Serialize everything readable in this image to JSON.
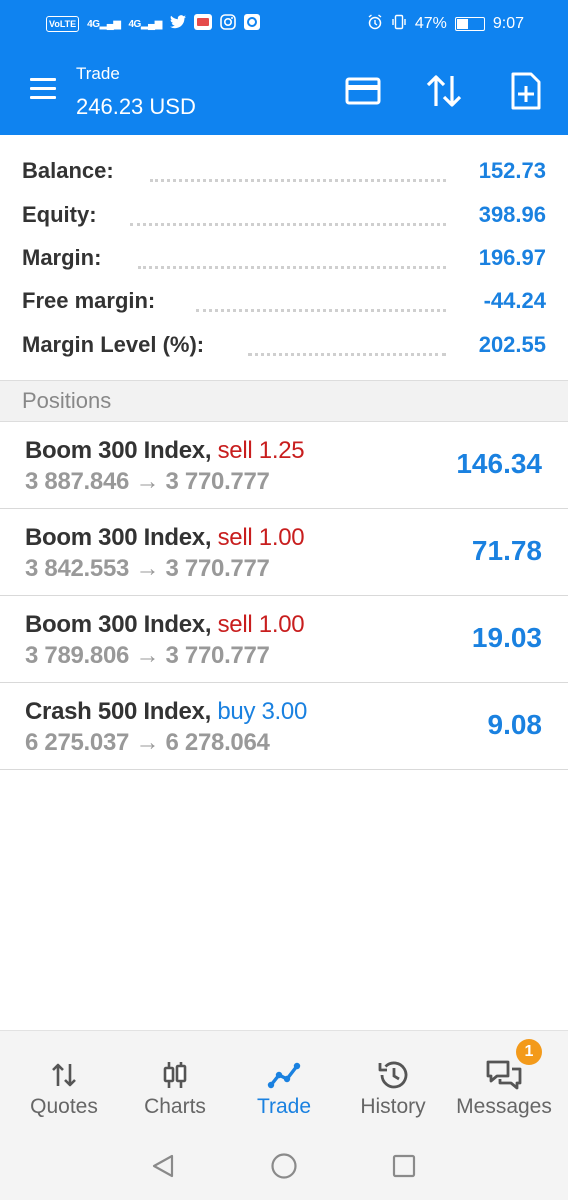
{
  "status_bar": {
    "left_icons": [
      "volte-icon",
      "4g-signal-icon",
      "4g-signal-2-icon",
      "twitter-icon",
      "app-icon",
      "instagram-icon",
      "app-2-icon"
    ],
    "volte": "VoLTE",
    "net1": "4G",
    "net2": "4G",
    "battery_percent": "47%",
    "battery_level": 0.47,
    "time": "9:07"
  },
  "app_bar": {
    "title": "Trade",
    "subtitle": "246.23 USD"
  },
  "summary": [
    {
      "label": "Balance:",
      "value": "152.73"
    },
    {
      "label": "Equity:",
      "value": "398.96"
    },
    {
      "label": "Margin:",
      "value": "196.97"
    },
    {
      "label": "Free margin:",
      "value": "-44.24"
    },
    {
      "label": "Margin Level (%):",
      "value": "202.55"
    }
  ],
  "positions_header": "Positions",
  "positions": [
    {
      "symbol": "Boom 300 Index,",
      "side": "sell 1.25",
      "side_type": "sell",
      "prices": "3 887.846 → 3 770.777",
      "profit": "146.34"
    },
    {
      "symbol": "Boom 300 Index,",
      "side": "sell 1.00",
      "side_type": "sell",
      "prices": "3 842.553 → 3 770.777",
      "profit": "71.78"
    },
    {
      "symbol": "Boom 300 Index,",
      "side": "sell 1.00",
      "side_type": "sell",
      "prices": "3 789.806 → 3 770.777",
      "profit": "19.03"
    },
    {
      "symbol": "Crash 500 Index,",
      "side": "buy 3.00",
      "side_type": "buy",
      "prices": "6 275.037 → 6 278.064",
      "profit": "9.08"
    }
  ],
  "bottom_nav": [
    {
      "label": "Quotes",
      "icon": "quotes-icon",
      "active": false
    },
    {
      "label": "Charts",
      "icon": "charts-icon",
      "active": false
    },
    {
      "label": "Trade",
      "icon": "trade-icon",
      "active": true
    },
    {
      "label": "History",
      "icon": "history-icon",
      "active": false
    },
    {
      "label": "Messages",
      "icon": "messages-icon",
      "active": false,
      "badge": "1"
    }
  ],
  "colors": {
    "brand_blue": "#0f83f0",
    "value_blue": "#1a81e0",
    "sell_red": "#c81e1e",
    "badge_orange": "#f39a1a"
  }
}
